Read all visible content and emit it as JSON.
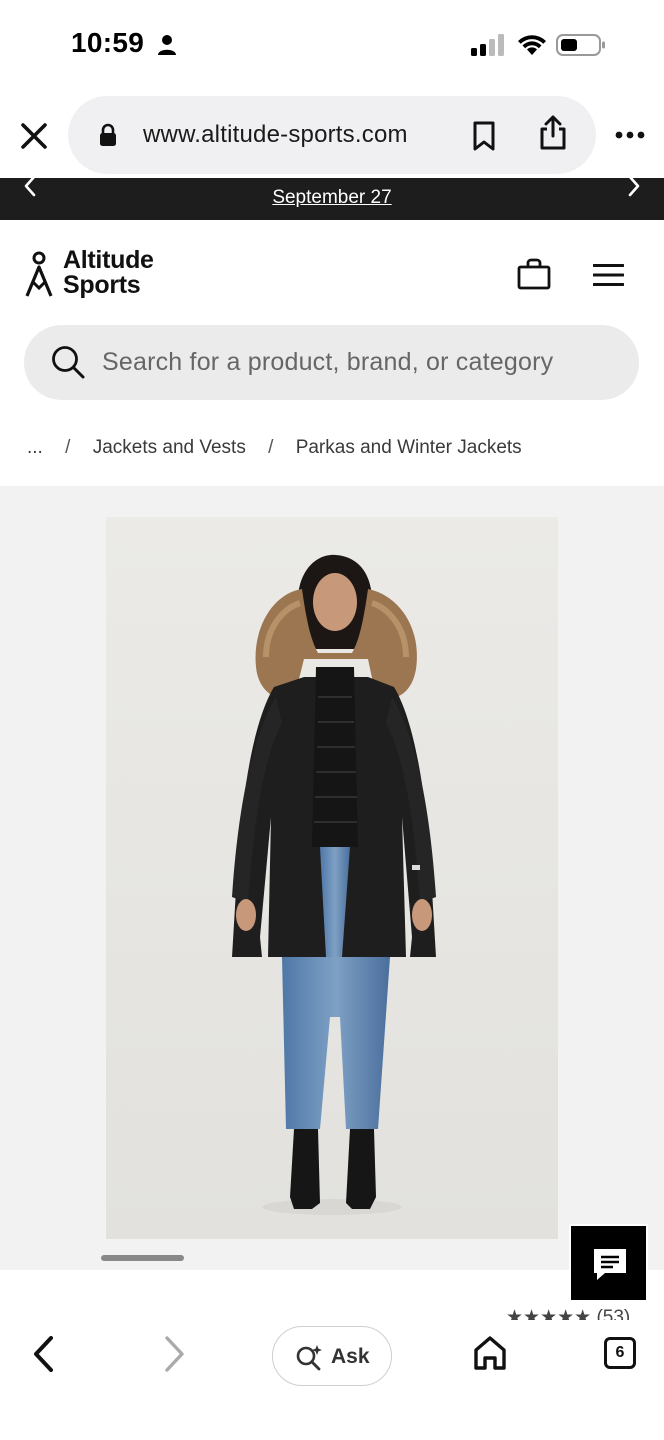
{
  "status_bar": {
    "time": "10:59"
  },
  "browser": {
    "url": "www.altitude-sports.com",
    "icons": [
      "close-icon",
      "lock-icon",
      "bookmark-icon",
      "share-icon",
      "more-icon"
    ]
  },
  "promo": {
    "text": "September 27"
  },
  "header": {
    "logo_line1": "Altitude",
    "logo_line2": "Sports"
  },
  "search": {
    "placeholder": "Search for a product, brand, or category"
  },
  "breadcrumb": {
    "ellipsis": "...",
    "separator": "/",
    "item1": "Jackets and Vests",
    "item2": "Parkas and Winter Jackets"
  },
  "product": {
    "rating_peek": "★★★★★ (53)"
  },
  "toolbar": {
    "ask_label": "Ask",
    "tabs_count": "6"
  },
  "colors": {
    "promo_bg": "#1d1d1d",
    "search_bg": "#ebebeb",
    "gallery_bg": "#f2f2f2",
    "chat_bg": "#000000"
  }
}
